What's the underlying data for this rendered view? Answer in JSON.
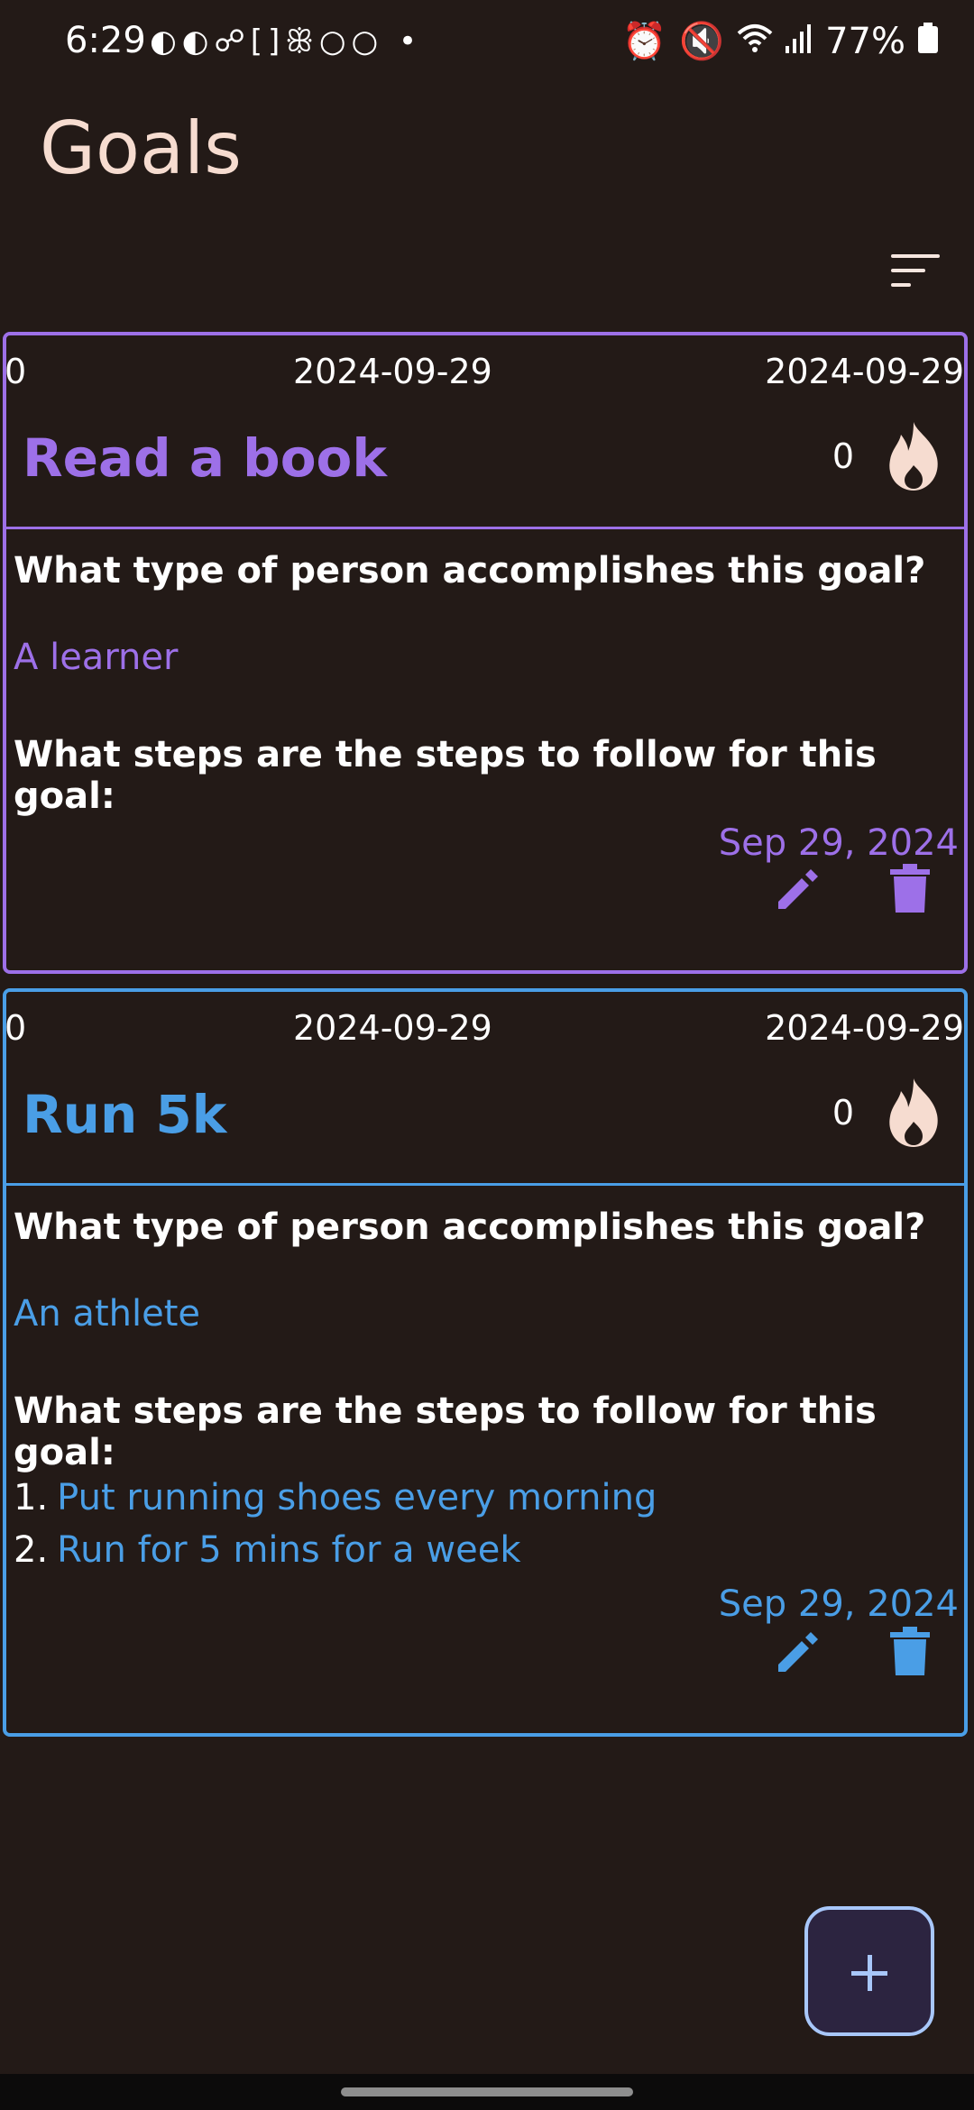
{
  "status_bar": {
    "time": "6:29",
    "left_icons": "◐◐☍[]ꕥ○○ •",
    "battery": "77%"
  },
  "header": {
    "title": "Goals"
  },
  "colors": {
    "purple": "#9d70e8",
    "blue": "#4a9ee6",
    "background": "#231a17",
    "fab_accent": "#a8c7fa"
  },
  "goals": [
    {
      "start_value": "0",
      "date_left": "2024-09-29",
      "date_right": "2024-09-29",
      "title": "Read a book",
      "streak": "0",
      "question_identity": "What type of person accomplishes this goal?",
      "identity": "A learner",
      "question_steps": "What steps are the steps to follow for this goal:",
      "steps": [],
      "created_date": "Sep 29, 2024"
    },
    {
      "start_value": "0",
      "date_left": "2024-09-29",
      "date_right": "2024-09-29",
      "title": "Run 5k",
      "streak": "0",
      "question_identity": "What type of person accomplishes this goal?",
      "identity": "An athlete",
      "question_steps": "What steps are the steps to follow for this goal:",
      "steps": [
        {
          "num": "1.",
          "text": "Put running shoes every morning"
        },
        {
          "num": "2.",
          "text": "Run for 5 mins for a week"
        }
      ],
      "created_date": "Sep 29, 2024"
    }
  ],
  "icons": {
    "sort": "sort-icon",
    "streak": "flame-icon",
    "edit": "pencil-icon",
    "delete": "trash-icon",
    "add": "plus-icon"
  }
}
